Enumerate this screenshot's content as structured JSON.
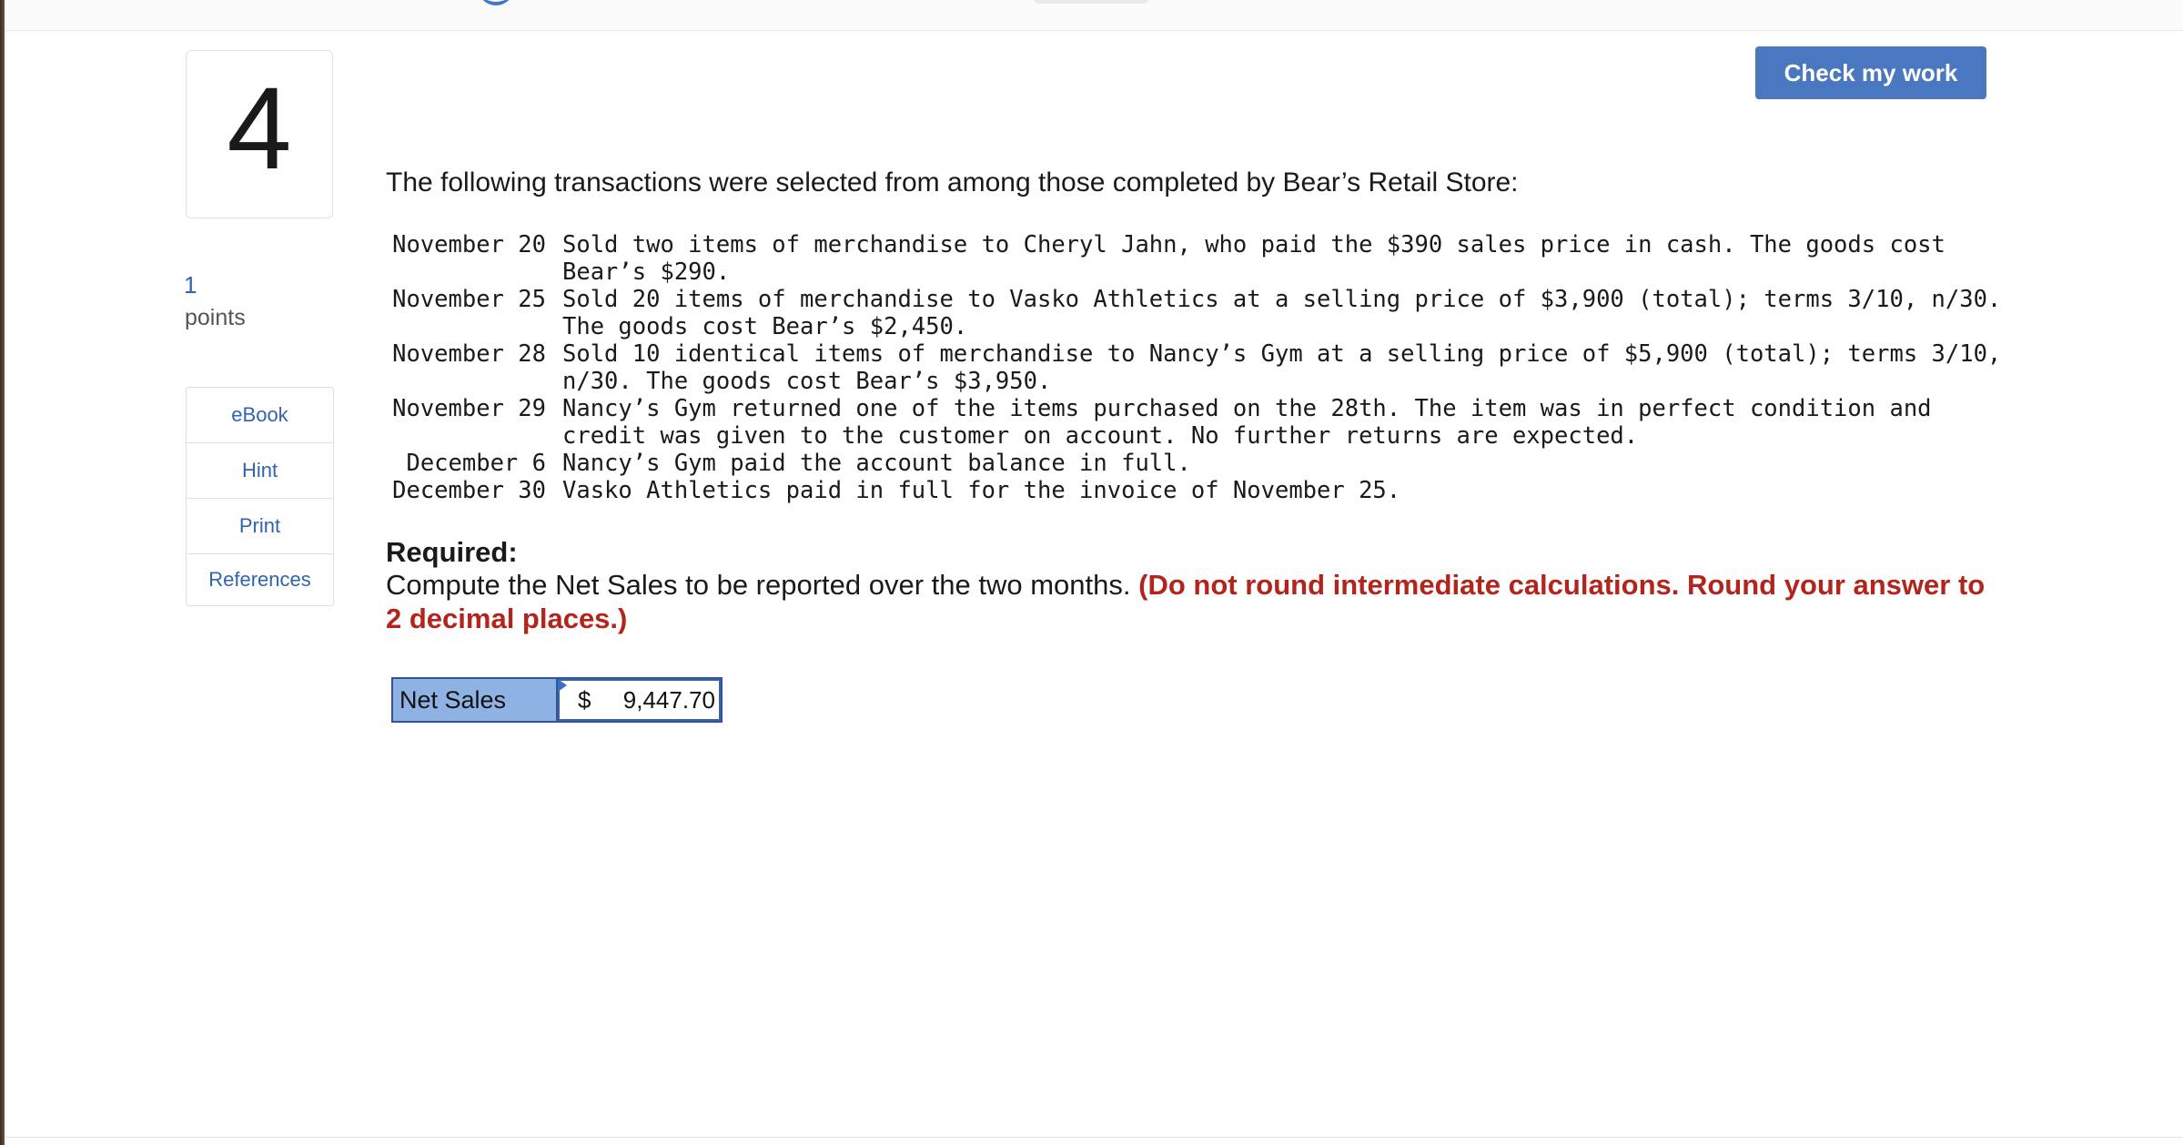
{
  "question": {
    "number": "4",
    "points_value": "1",
    "points_label": "points"
  },
  "tools": [
    {
      "label": "eBook"
    },
    {
      "label": "Hint"
    },
    {
      "label": "Print"
    },
    {
      "label": "References"
    }
  ],
  "header": {
    "check_button_label": "Check my work"
  },
  "problem": {
    "intro": "The following transactions were selected from among those completed by Bear’s Retail Store:",
    "transactions": [
      {
        "date": "November 20",
        "description": "Sold two items of merchandise to Cheryl Jahn, who paid the $390 sales price in cash. The goods cost Bear’s $290."
      },
      {
        "date": "November 25",
        "description": "Sold 20 items of merchandise to Vasko Athletics at a selling price of $3,900 (total); terms 3/10, n/30. The goods cost Bear’s $2,450."
      },
      {
        "date": "November 28",
        "description": "Sold 10 identical items of merchandise to Nancy’s Gym at a selling price of $5,900 (total); terms 3/10, n/30. The goods cost Bear’s $3,950."
      },
      {
        "date": "November 29",
        "description": "Nancy’s Gym returned one of the items purchased on the 28th. The item was in perfect condition and credit was given to the customer on account. No further returns are expected."
      },
      {
        "date": "December 6",
        "description": "Nancy’s Gym paid the account balance in full."
      },
      {
        "date": "December 30",
        "description": "Vasko Athletics paid in full for the invoice of November 25."
      }
    ],
    "required_heading": "Required:",
    "required_text": "Compute the Net Sales to be reported over the two months.",
    "required_note": "(Do not round intermediate calculations. Round your answer to 2 decimal places.)"
  },
  "answer": {
    "label": "Net Sales",
    "currency": "$",
    "value": "9,447.70"
  },
  "colors": {
    "accent": "#4a78c0",
    "link": "#2f64b3",
    "note_red": "#b3251c",
    "label_fill": "#8eb2e3",
    "table_border": "#2f5597"
  }
}
